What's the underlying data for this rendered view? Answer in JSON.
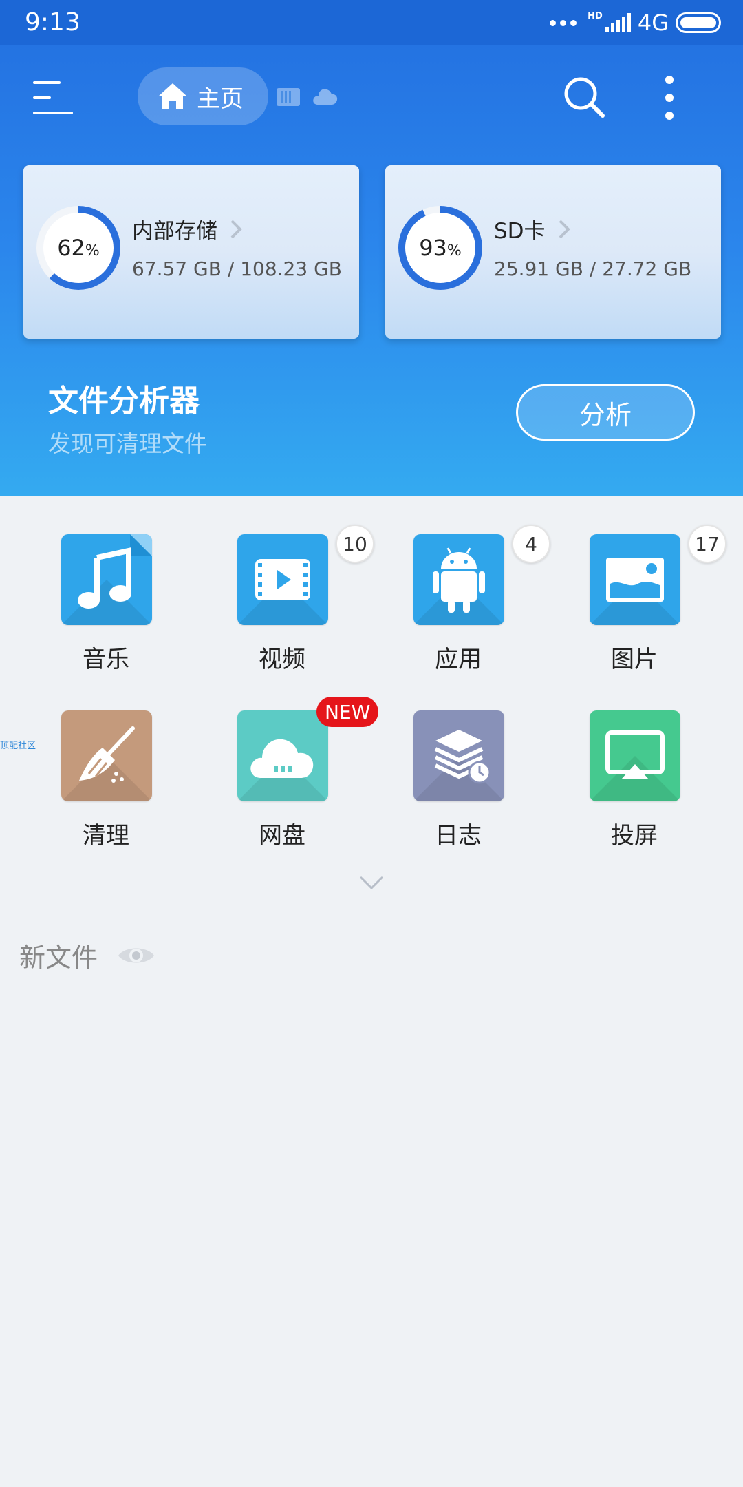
{
  "status_bar": {
    "time": "9:13",
    "hd": "HD",
    "network": "4G"
  },
  "header": {
    "home_tab": "主页",
    "menu_icon": "hamburger-menu-icon",
    "search_icon": "search-icon",
    "more_icon": "more-vertical-icon"
  },
  "storage": [
    {
      "name": "内部存储",
      "percent": "62",
      "percent_value": 62,
      "used": "67.57 GB / 108.23 GB"
    },
    {
      "name": "SD卡",
      "percent": "93",
      "percent_value": 93,
      "used": "25.91 GB / 27.72 GB"
    }
  ],
  "analyzer": {
    "title": "文件分析器",
    "subtitle": "发现可清理文件",
    "button": "分析"
  },
  "categories": [
    {
      "label": "音乐",
      "icon": "music-icon",
      "badge": ""
    },
    {
      "label": "视频",
      "icon": "video-icon",
      "badge": "10"
    },
    {
      "label": "应用",
      "icon": "android-icon",
      "badge": "4"
    },
    {
      "label": "图片",
      "icon": "image-icon",
      "badge": "17"
    },
    {
      "label": "清理",
      "icon": "broom-icon",
      "badge": ""
    },
    {
      "label": "网盘",
      "icon": "cloud-drive-icon",
      "badge": "NEW"
    },
    {
      "label": "日志",
      "icon": "log-history-icon",
      "badge": ""
    },
    {
      "label": "投屏",
      "icon": "screen-cast-icon",
      "badge": ""
    }
  ],
  "side_tag": "顶配社区",
  "new_files": {
    "title": "新文件",
    "icon": "eye-icon"
  },
  "colors": {
    "status_bar": "#1c67d6",
    "header_top": "#2473e2",
    "header_bottom": "#34aaf0",
    "ring": "#2a6fdc",
    "tile_blue": "#2fa5ea",
    "tile_brown": "#c49a7c",
    "tile_teal": "#5ccbc5",
    "tile_slate": "#8891b8",
    "tile_green": "#45c98f",
    "badge_new": "#e5151a"
  }
}
